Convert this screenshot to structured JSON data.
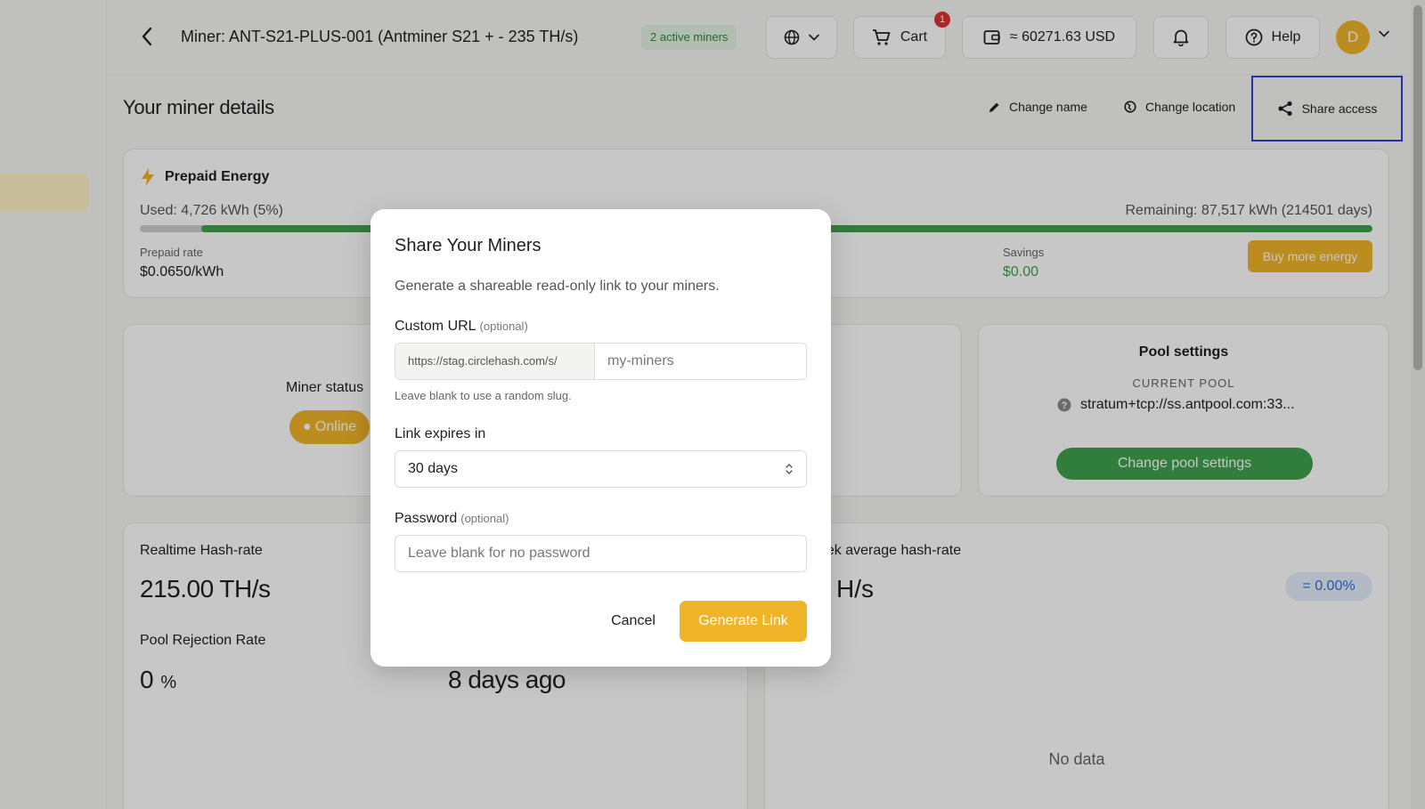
{
  "header": {
    "title": "Miner: ANT-S21-PLUS-001 (Antminer S21 + - 235 TH/s)",
    "active_badge": "2 active miners",
    "cart_label": "Cart",
    "cart_count": "1",
    "wallet_label": "≈ 60271.63 USD",
    "help_label": "Help",
    "avatar_initial": "D"
  },
  "section": {
    "title": "Your miner details",
    "actions": {
      "change_name": "Change name",
      "change_location": "Change location",
      "share_access": "Share access"
    }
  },
  "energy": {
    "title": "Prepaid Energy",
    "used": "Used: 4,726 kWh (5%)",
    "remaining": "Remaining: 87,517 kWh (214501 days)",
    "used_fraction": 0.05,
    "rate_label": "Prepaid rate",
    "rate_value": "$0.0650/kWh",
    "savings_label": "Savings",
    "savings_value": "$0.00",
    "buy_button": "Buy more energy"
  },
  "status": {
    "label": "Miner status",
    "online": "Online"
  },
  "pool": {
    "title": "Pool settings",
    "subtitle": "CURRENT POOL",
    "value": "stratum+tcp://ss.antpool.com:33...",
    "button": "Change pool settings"
  },
  "hashrate": {
    "label": "Realtime Hash-rate",
    "value": "215.00 TH/s",
    "rejection_label": "Pool Rejection Rate",
    "rejection_value": "0",
    "rejection_unit": "%",
    "last_seen": "8 days ago"
  },
  "week": {
    "label": "eek average hash-rate",
    "value": "H/s",
    "change": "0.00%",
    "no_data": "No data"
  },
  "modal": {
    "title": "Share Your Miners",
    "description": "Generate a shareable read-only link to your miners.",
    "custom_url_label": "Custom URL",
    "optional": "(optional)",
    "url_prefix": "https://stag.circlehash.com/s/",
    "url_placeholder": "my-miners",
    "url_hint": "Leave blank to use a random slug.",
    "expires_label": "Link expires in",
    "expires_value": "30 days",
    "password_label": "Password",
    "password_placeholder": "Leave blank for no password",
    "cancel": "Cancel",
    "generate": "Generate Link"
  },
  "colors": {
    "accent": "#f0b429",
    "success": "#3fa14d",
    "danger": "#e03131",
    "highlight": "#2f3fd6"
  }
}
